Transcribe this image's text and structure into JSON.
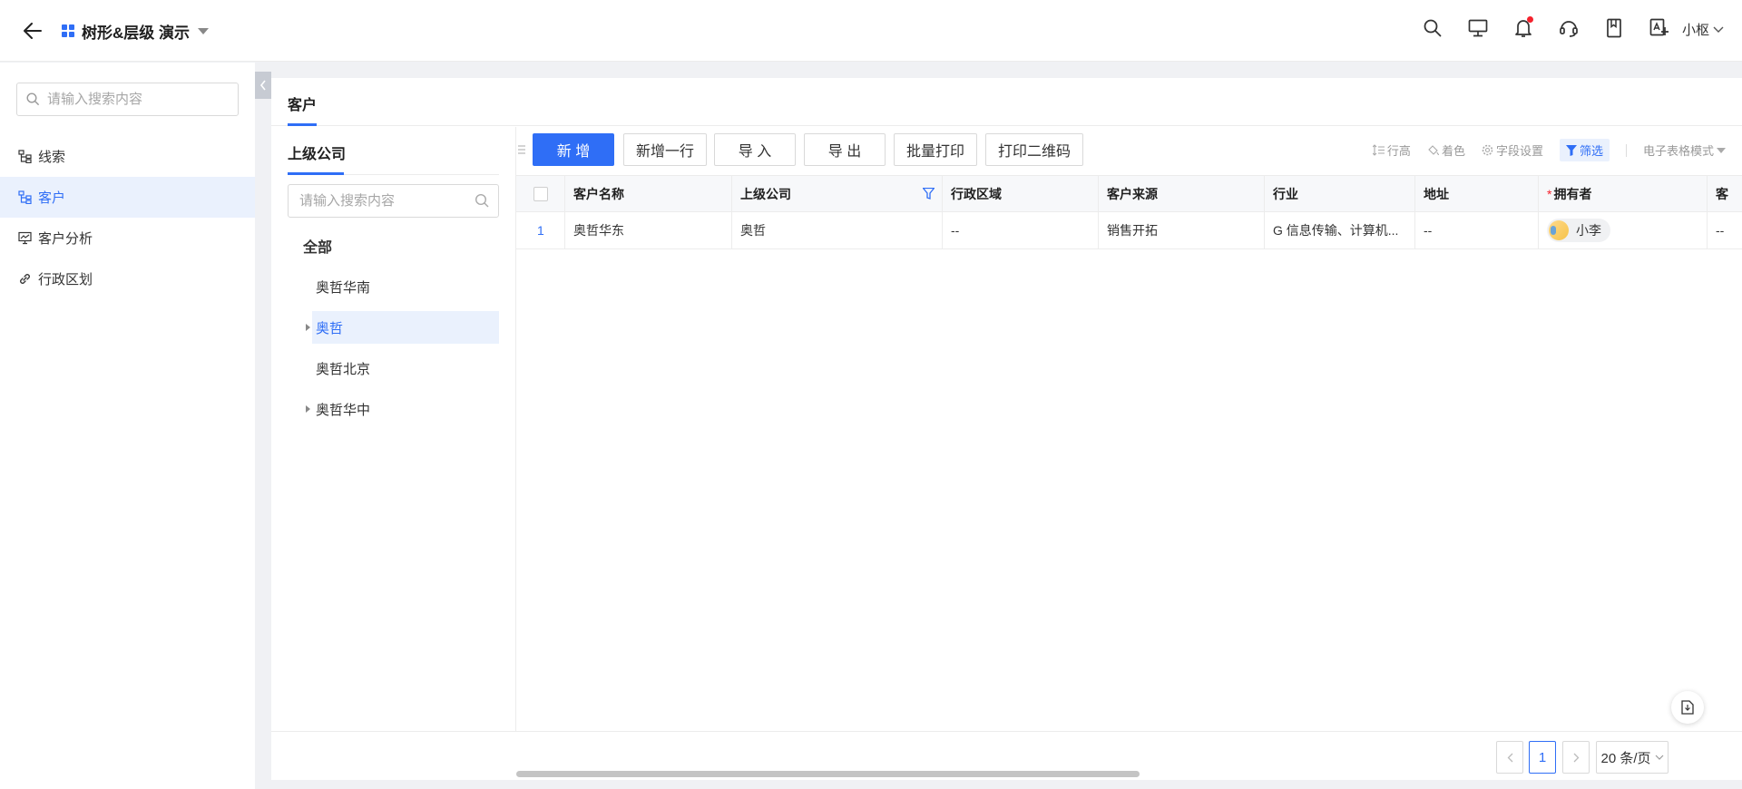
{
  "header": {
    "back_icon": "arrow-left-icon",
    "app_icon": "grid-icon",
    "app_title": "树形&层级 演示",
    "user_name": "小枢",
    "accent": "#2f6ef6",
    "notification_dot_color": "#f5222d"
  },
  "sidebar": {
    "search_placeholder": "请输入搜索内容",
    "items": [
      {
        "label": "线索",
        "icon": "tree-icon",
        "active": false
      },
      {
        "label": "客户",
        "icon": "tree-icon",
        "active": true
      },
      {
        "label": "客户分析",
        "icon": "chart-monitor-icon",
        "active": false
      },
      {
        "label": "行政区划",
        "icon": "link-icon",
        "active": false
      }
    ]
  },
  "main": {
    "tab_label": "客户"
  },
  "tree": {
    "title": "上级公司",
    "search_placeholder": "请输入搜索内容",
    "root": "全部",
    "nodes": [
      {
        "label": "奥哲华南",
        "has_children": false,
        "selected": false
      },
      {
        "label": "奥哲",
        "has_children": true,
        "selected": true
      },
      {
        "label": "奥哲北京",
        "has_children": false,
        "selected": false
      },
      {
        "label": "奥哲华中",
        "has_children": true,
        "selected": false
      }
    ]
  },
  "toolbar": {
    "add": "新 增",
    "add_row": "新增一行",
    "import": "导 入",
    "export": "导 出",
    "batch_print": "批量打印",
    "print_qr": "打印二维码",
    "row_height": "行高",
    "coloring": "着色",
    "field_settings": "字段设置",
    "filter": "筛选",
    "spreadsheet_mode": "电子表格模式"
  },
  "table": {
    "columns": [
      "客户名称",
      "上级公司",
      "行政区域",
      "客户来源",
      "行业",
      "地址",
      "拥有者",
      "客"
    ],
    "required_columns": [
      "拥有者"
    ],
    "rows": [
      {
        "index": "1",
        "customer_name": "奥哲华东",
        "parent_company": "奥哲",
        "region": "--",
        "source": "销售开拓",
        "industry": "G 信息传输、计算机...",
        "address": "--",
        "owner": "小李",
        "extra": "--"
      }
    ]
  },
  "pagination": {
    "current_page": "1",
    "page_size": "20 条/页"
  }
}
